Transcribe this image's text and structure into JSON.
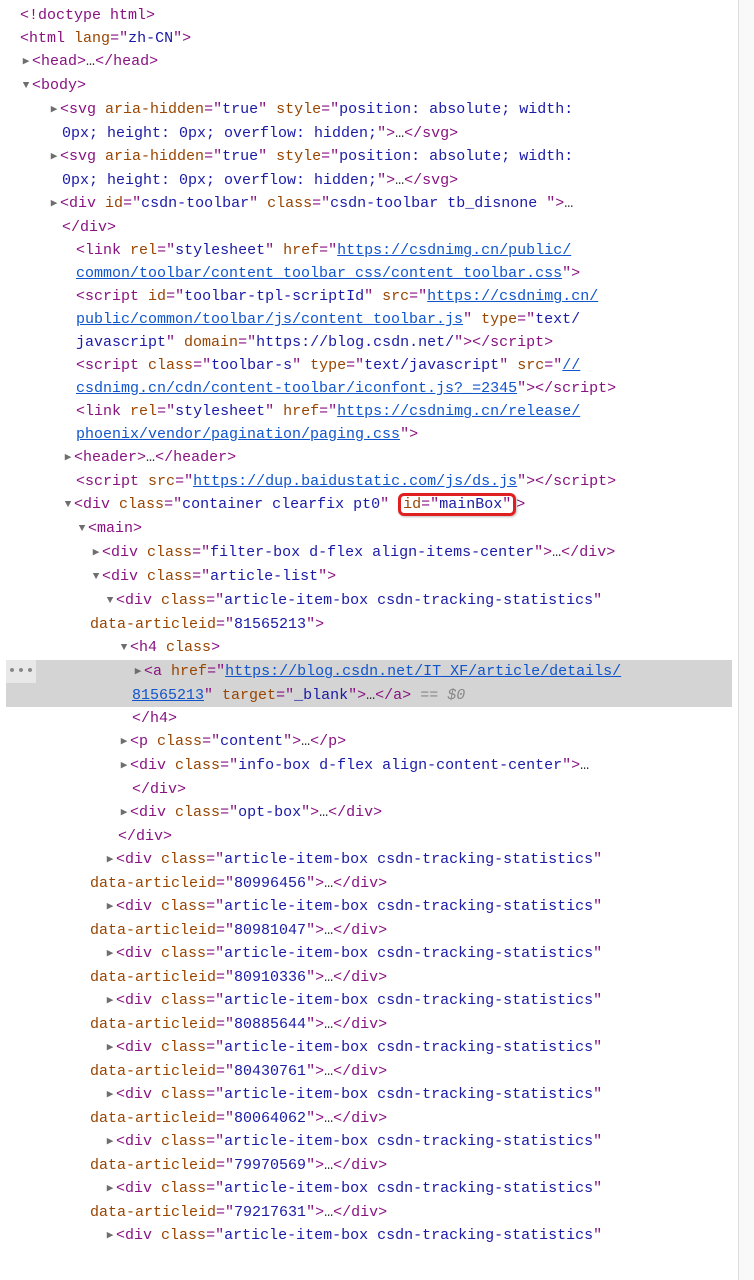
{
  "doctype": "<!doctype html>",
  "htmlOpen": {
    "tag": "html",
    "lang": "zh-CN"
  },
  "head": {
    "open": "head",
    "ellipsis": "…",
    "close": "head"
  },
  "body": {
    "tag": "body"
  },
  "svg1": {
    "tag": "svg",
    "ariaHidden": "true",
    "style": "position: absolute; width: 0px; height: 0px; overflow: hidden;",
    "ellipsis": "…"
  },
  "svg2": {
    "tag": "svg",
    "ariaHidden": "true",
    "style": "position: absolute; width: 0px; height: 0px; overflow: hidden;",
    "ellipsis": "…"
  },
  "toolbarDiv": {
    "tag": "div",
    "id": "csdn-toolbar",
    "class": "csdn-toolbar tb_disnone ",
    "ellipsis": "…"
  },
  "link1": {
    "rel": "stylesheet",
    "href": "https://csdnimg.cn/public/common/toolbar/content_toolbar_css/content_toolbar.css"
  },
  "script1": {
    "id": "toolbar-tpl-scriptId",
    "src": "https://csdnimg.cn/public/common/toolbar/js/content_toolbar.js",
    "type": "text/javascript",
    "domain": "https://blog.csdn.net/"
  },
  "script2": {
    "class": "toolbar-s",
    "type": "text/javascript",
    "src": "//csdnimg.cn/cdn/content-toolbar/iconfont.js?_=2345"
  },
  "link2": {
    "rel": "stylesheet",
    "href": "https://csdnimg.cn/release/phoenix/vendor/pagination/paging.css"
  },
  "header": {
    "tag": "header",
    "ellipsis": "…"
  },
  "script3": {
    "src": "https://dup.baidustatic.com/js/ds.js"
  },
  "mainBox": {
    "tag": "div",
    "class": "container clearfix pt0",
    "idLabel": "id",
    "idVal": "mainBox"
  },
  "main": {
    "tag": "main"
  },
  "filterBox": {
    "tag": "div",
    "class": "filter-box d-flex align-items-center",
    "ellipsis": "…"
  },
  "articleList": {
    "tag": "div",
    "class": "article-list"
  },
  "articleItem1": {
    "tag": "div",
    "class": "article-item-box csdn-tracking-statistics",
    "dataArticleId": "81565213"
  },
  "h4": {
    "tag": "h4",
    "classAttr": "class"
  },
  "anchor": {
    "href": "https://blog.csdn.net/IT_XF/article/details/81565213",
    "target": "_blank",
    "ellipsis": "…",
    "eqDollar": "== $0"
  },
  "h4close": "h4",
  "pContent": {
    "tag": "p",
    "class": "content",
    "ellipsis": "…"
  },
  "infoBox": {
    "tag": "div",
    "class": "info-box d-flex align-content-center",
    "ellipsis": "…"
  },
  "optBox": {
    "tag": "div",
    "class": "opt-box",
    "ellipsis": "…"
  },
  "articleItems": [
    {
      "id": "80996456"
    },
    {
      "id": "80981047"
    },
    {
      "id": "80910336"
    },
    {
      "id": "80885644"
    },
    {
      "id": "80430761"
    },
    {
      "id": "80064062"
    },
    {
      "id": "79970569"
    },
    {
      "id": "79217631"
    }
  ],
  "articleItemClass": "article-item-box csdn-tracking-statistics",
  "articleLast": {
    "class": "article-item-box csdn-tracking-statistics"
  },
  "selectedDots": "•••"
}
